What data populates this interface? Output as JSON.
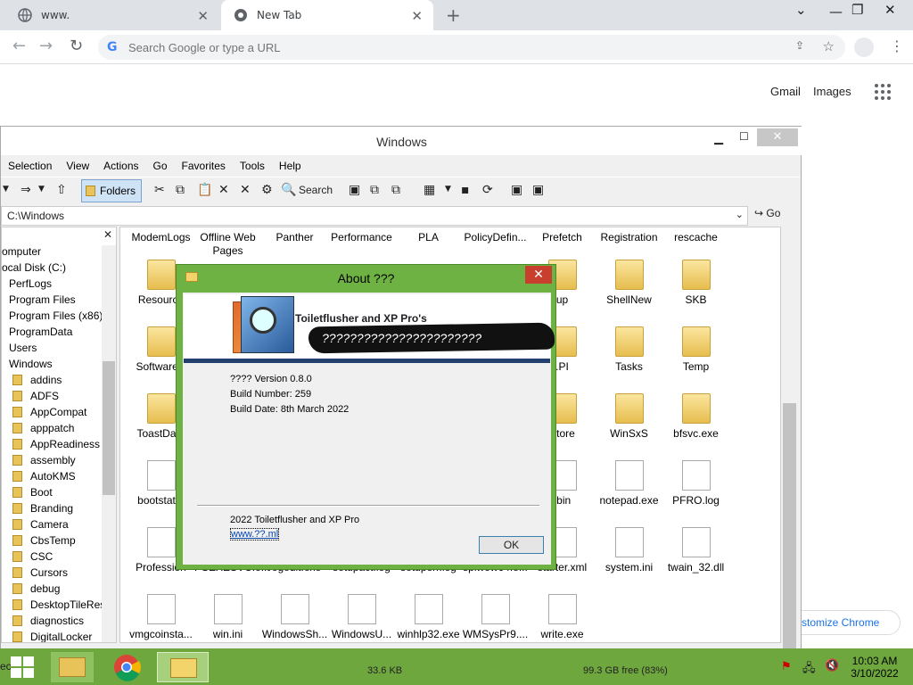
{
  "browser": {
    "tabs": [
      {
        "label": "www.",
        "active": false
      },
      {
        "label": "New Tab",
        "active": true
      }
    ],
    "omnibox_placeholder": "Search Google or type a URL",
    "links": {
      "gmail": "Gmail",
      "images": "Images"
    },
    "customize": "stomize Chrome"
  },
  "explorer": {
    "title": "Windows",
    "menu": [
      "Selection",
      "View",
      "Actions",
      "Go",
      "Favorites",
      "Tools",
      "Help"
    ],
    "toolbar": {
      "folders": "Folders",
      "search": "Search"
    },
    "address": "C:\\Windows",
    "go": "Go",
    "tree": [
      {
        "label": "omputer",
        "indent": 0,
        "folder": false
      },
      {
        "label": "ocal Disk (C:)",
        "indent": 0,
        "folder": false
      },
      {
        "label": "PerfLogs",
        "indent": 1,
        "folder": true
      },
      {
        "label": "Program Files",
        "indent": 1,
        "folder": true
      },
      {
        "label": "Program Files (x86)",
        "indent": 1,
        "folder": true
      },
      {
        "label": "ProgramData",
        "indent": 1,
        "folder": true
      },
      {
        "label": "Users",
        "indent": 1,
        "folder": true
      },
      {
        "label": "Windows",
        "indent": 1,
        "folder": true
      },
      {
        "label": "addins",
        "indent": 2,
        "folder": true
      },
      {
        "label": "ADFS",
        "indent": 2,
        "folder": true
      },
      {
        "label": "AppCompat",
        "indent": 2,
        "folder": true
      },
      {
        "label": "apppatch",
        "indent": 2,
        "folder": true
      },
      {
        "label": "AppReadiness",
        "indent": 2,
        "folder": true
      },
      {
        "label": "assembly",
        "indent": 2,
        "folder": true
      },
      {
        "label": "AutoKMS",
        "indent": 2,
        "folder": true
      },
      {
        "label": "Boot",
        "indent": 2,
        "folder": true
      },
      {
        "label": "Branding",
        "indent": 2,
        "folder": true
      },
      {
        "label": "Camera",
        "indent": 2,
        "folder": true
      },
      {
        "label": "CbsTemp",
        "indent": 2,
        "folder": true
      },
      {
        "label": "CSC",
        "indent": 2,
        "folder": true
      },
      {
        "label": "Cursors",
        "indent": 2,
        "folder": true
      },
      {
        "label": "debug",
        "indent": 2,
        "folder": true
      },
      {
        "label": "DesktopTileRes",
        "indent": 2,
        "folder": true
      },
      {
        "label": "diagnostics",
        "indent": 2,
        "folder": true
      },
      {
        "label": "DigitalLocker",
        "indent": 2,
        "folder": true
      }
    ],
    "files": [
      [
        "ModemLogs",
        "Offline Web Pages",
        "Panther",
        "Performance",
        "PLA",
        "PolicyDefin...",
        "Prefetch",
        "Registration",
        "rescache"
      ],
      [
        "Resource",
        "",
        "",
        "",
        "",
        "",
        "up",
        "ShellNew",
        "SKB"
      ],
      [
        "SoftwareD",
        "",
        "",
        "",
        "",
        "",
        ".PI",
        "Tasks",
        "Temp"
      ],
      [
        "ToastData",
        "",
        "",
        "",
        "",
        "",
        "Store",
        "WinSxS",
        "bfsvc.exe"
      ],
      [
        "bootstat.d",
        "",
        "",
        "",
        "",
        "",
        ".bin",
        "notepad.exe",
        "PFRO.log"
      ],
      [
        "Profession",
        "PSEXESVC.e...",
        "regedit.exe",
        "setupact.log",
        "setuperr.log",
        "splwow64.e...",
        "starter.xml",
        "system.ini",
        "twain_32.dll"
      ],
      [
        "vmgcoinsta...",
        "win.ini",
        "WindowsSh...",
        "WindowsU...",
        "winhlp32.exe",
        "WMSysPr9....",
        "write.exe",
        "",
        ""
      ]
    ],
    "status": {
      "size": "33.6 KB",
      "free": "99.3 GB free (83%)"
    }
  },
  "about": {
    "title": "About ???",
    "product": "Toiletflusher and XP Pro's",
    "tagline": "???????????????????????",
    "version": "???? Version 0.8.0",
    "build_number": "Build Number: 259",
    "build_date": "Build Date: 8th March 2022",
    "copyright": "2022 Toiletflusher and XP Pro",
    "link": "www.??.ml",
    "ok": "OK"
  },
  "taskbar": {
    "time": "10:03 AM",
    "date": "3/10/2022",
    "start_fragment": "ec"
  }
}
